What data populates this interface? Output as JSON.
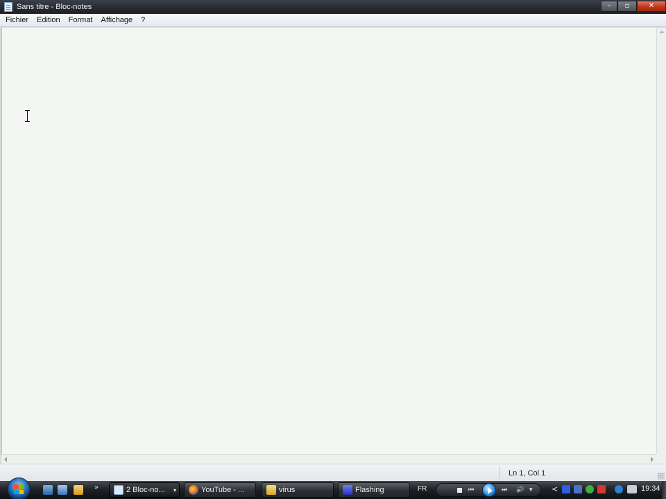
{
  "window": {
    "title": "Sans titre - Bloc-notes",
    "controls": {
      "minimize": "–",
      "maximize": "▫",
      "close": "✕"
    }
  },
  "menu": {
    "items": [
      "Fichier",
      "Edition",
      "Format",
      "Affichage",
      "?"
    ]
  },
  "editor": {
    "content": ""
  },
  "status": {
    "position": "Ln 1, Col 1"
  },
  "taskbar": {
    "quick_launch_more": "»",
    "tasks": [
      {
        "label": "2 Bloc-no...",
        "icon": "notepad-icon",
        "caret": "▾"
      },
      {
        "label": "YouTube - ...",
        "icon": "firefox-icon"
      },
      {
        "label": "virus",
        "icon": "folder-icon"
      },
      {
        "label": "Flashing",
        "icon": "app-icon"
      }
    ],
    "language": "FR",
    "media": {
      "prev": "⏮",
      "next": "⏭",
      "volume": "🔊",
      "dropdown": "▾"
    },
    "tray_expand": "<",
    "clock": "19:34"
  },
  "colors": {
    "titlebar": "#262b30",
    "editor_bg": "#f4f6f3",
    "close_button": "#c0361c",
    "taskbar": "#1f2226"
  }
}
